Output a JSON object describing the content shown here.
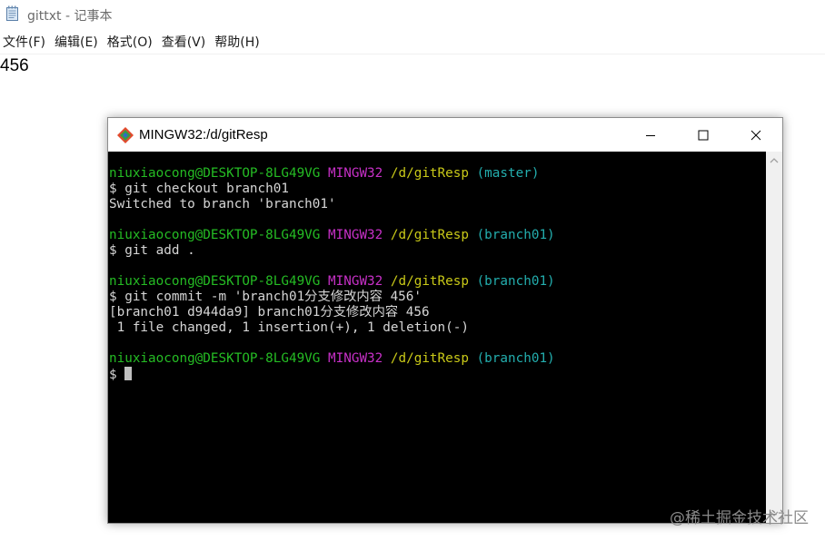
{
  "notepad": {
    "title": "gittxt - 记事本",
    "menu": [
      "文件(F)",
      "编辑(E)",
      "格式(O)",
      "查看(V)",
      "帮助(H)"
    ],
    "content": "456",
    "icon": "notepad-icon"
  },
  "terminal": {
    "title": "MINGW32:/d/gitResp",
    "icon": "git-bash-icon",
    "lines": [
      {
        "kind": "prompt",
        "user": "niuxiaocong@DESKTOP-8LG49VG",
        "env": "MINGW32",
        "path": "/d/gitResp",
        "branch": "(master)"
      },
      {
        "kind": "text",
        "text": "$ git checkout branch01"
      },
      {
        "kind": "text",
        "text": "Switched to branch 'branch01'"
      },
      {
        "kind": "blank",
        "text": ""
      },
      {
        "kind": "prompt",
        "user": "niuxiaocong@DESKTOP-8LG49VG",
        "env": "MINGW32",
        "path": "/d/gitResp",
        "branch": "(branch01)"
      },
      {
        "kind": "text",
        "text": "$ git add ."
      },
      {
        "kind": "blank",
        "text": ""
      },
      {
        "kind": "prompt",
        "user": "niuxiaocong@DESKTOP-8LG49VG",
        "env": "MINGW32",
        "path": "/d/gitResp",
        "branch": "(branch01)"
      },
      {
        "kind": "text",
        "text": "$ git commit -m 'branch01分支修改内容 456'"
      },
      {
        "kind": "text",
        "text": "[branch01 d944da9] branch01分支修改内容 456"
      },
      {
        "kind": "text",
        "text": " 1 file changed, 1 insertion(+), 1 deletion(-)"
      },
      {
        "kind": "blank",
        "text": ""
      },
      {
        "kind": "prompt",
        "user": "niuxiaocong@DESKTOP-8LG49VG",
        "env": "MINGW32",
        "path": "/d/gitResp",
        "branch": "(branch01)"
      },
      {
        "kind": "input",
        "text": "$ "
      }
    ]
  },
  "watermark": "@稀土掘金技术社区",
  "colors": {
    "prompt_user": "#25bc24",
    "prompt_env": "#c730c7",
    "prompt_path": "#c9c918",
    "prompt_branch": "#23aeae",
    "terminal_bg": "#000000",
    "terminal_text": "#c0c0c0"
  }
}
